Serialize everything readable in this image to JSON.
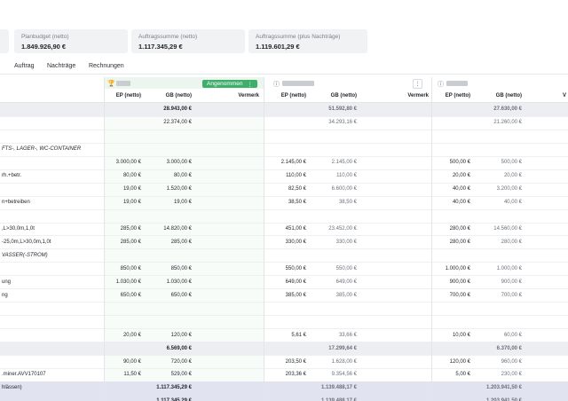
{
  "cards": [
    {
      "label": "Planbudget (netto)",
      "value": "1.849.926,90 €"
    },
    {
      "label": "Auftragssumme (netto)",
      "value": "1.117.345,29 €"
    },
    {
      "label": "Auftragssumme (plus Nachträge)",
      "value": "1.119.601,29 €"
    }
  ],
  "tabs": [
    "Auftrag",
    "Nachträge",
    "Rechnungen"
  ],
  "columns": {
    "status_badge": "Angenommen",
    "menu_glyph": "⋮",
    "info_glyph": "ⓘ",
    "group_a": {
      "ep": "EP (netto)",
      "gb": "GB (netto)",
      "vermerk": "Vermerk"
    },
    "group_b": {
      "ep": "EP (netto)",
      "gb": "GB (netto)",
      "vermerk": "Vermerk"
    },
    "group_c": {
      "ep": "EP (netto)",
      "gb": "GB (netto)",
      "vermerk": "V"
    }
  },
  "rows": [
    {
      "type": "sub",
      "desc": "",
      "a_ep": "",
      "a_gb": "28.943,00 €",
      "b_ep": "",
      "b_gb": "51.592,80 €",
      "c_ep": "",
      "c_gb": "27.630,00 €"
    },
    {
      "type": "plain",
      "desc": "",
      "a_ep": "",
      "a_gb": "22.374,00 €",
      "b_ep": "",
      "b_gb": "34.293,16 €",
      "c_ep": "",
      "c_gb": "21.260,00 €"
    },
    {
      "type": "plain",
      "desc": "",
      "a_ep": "",
      "a_gb": "",
      "b_ep": "",
      "b_gb": "",
      "c_ep": "",
      "c_gb": ""
    },
    {
      "type": "section",
      "desc": "FTS-, LAGER-, WC-CONTAINER",
      "a_ep": "",
      "a_gb": "",
      "b_ep": "",
      "b_gb": "",
      "c_ep": "",
      "c_gb": ""
    },
    {
      "type": "plain",
      "desc": "",
      "a_ep": "3.000,00 €",
      "a_gb": "3.000,00 €",
      "b_ep": "2.145,00 €",
      "b_gb": "2.145,00 €",
      "c_ep": "500,00 €",
      "c_gb": "500,00 €"
    },
    {
      "type": "plain",
      "desc": "rh.+betr.",
      "a_ep": "80,00 €",
      "a_gb": "80,00 €",
      "b_ep": "110,00 €",
      "b_gb": "110,00 €",
      "c_ep": "20,00 €",
      "c_gb": "20,00 €"
    },
    {
      "type": "plain",
      "desc": "",
      "a_ep": "19,00 €",
      "a_gb": "1.520,00 €",
      "b_ep": "82,50 €",
      "b_gb": "6.600,00 €",
      "c_ep": "40,00 €",
      "c_gb": "3.200,00 €"
    },
    {
      "type": "plain",
      "desc": "n+betreiben",
      "a_ep": "19,00 €",
      "a_gb": "19,00 €",
      "b_ep": "38,50 €",
      "b_gb": "38,50 €",
      "c_ep": "40,00 €",
      "c_gb": "40,00 €"
    },
    {
      "type": "plain",
      "desc": "",
      "a_ep": "",
      "a_gb": "",
      "b_ep": "",
      "b_gb": "",
      "c_ep": "",
      "c_gb": ""
    },
    {
      "type": "plain",
      "desc": ",L>30,0m,1,0t",
      "a_ep": "285,00 €",
      "a_gb": "14.820,00 €",
      "b_ep": "451,00 €",
      "b_gb": "23.452,00 €",
      "c_ep": "280,00 €",
      "c_gb": "14.560,00 €"
    },
    {
      "type": "plain",
      "desc": "-25,0m,L>30,0m,1,0t",
      "a_ep": "285,00 €",
      "a_gb": "285,00 €",
      "b_ep": "330,00 €",
      "b_gb": "330,00 €",
      "c_ep": "280,00 €",
      "c_gb": "280,00 €"
    },
    {
      "type": "section",
      "desc": "VASSER(-STROM)",
      "a_ep": "",
      "a_gb": "",
      "b_ep": "",
      "b_gb": "",
      "c_ep": "",
      "c_gb": ""
    },
    {
      "type": "plain",
      "desc": "",
      "a_ep": "850,00 €",
      "a_gb": "850,00 €",
      "b_ep": "550,00 €",
      "b_gb": "550,00 €",
      "c_ep": "1.000,00 €",
      "c_gb": "1.000,00 €"
    },
    {
      "type": "plain",
      "desc": "ung",
      "a_ep": "1.030,00 €",
      "a_gb": "1.030,00 €",
      "b_ep": "649,00 €",
      "b_gb": "649,00 €",
      "c_ep": "900,00 €",
      "c_gb": "900,00 €"
    },
    {
      "type": "plain",
      "desc": "ng",
      "a_ep": "650,00 €",
      "a_gb": "650,00 €",
      "b_ep": "385,00 €",
      "b_gb": "385,00 €",
      "c_ep": "700,00 €",
      "c_gb": "700,00 €"
    },
    {
      "type": "plain",
      "desc": "",
      "a_ep": "",
      "a_gb": "",
      "b_ep": "",
      "b_gb": "",
      "c_ep": "",
      "c_gb": ""
    },
    {
      "type": "plain",
      "desc": "",
      "a_ep": "",
      "a_gb": "",
      "b_ep": "",
      "b_gb": "",
      "c_ep": "",
      "c_gb": ""
    },
    {
      "type": "plain",
      "desc": "",
      "a_ep": "20,00 €",
      "a_gb": "120,00 €",
      "b_ep": "5,61 €",
      "b_gb": "33,66 €",
      "c_ep": "10,00 €",
      "c_gb": "60,00 €"
    },
    {
      "type": "sub",
      "desc": "",
      "a_ep": "",
      "a_gb": "6.569,00 €",
      "b_ep": "",
      "b_gb": "17.299,64 €",
      "c_ep": "",
      "c_gb": "6.370,00 €"
    },
    {
      "type": "plain",
      "desc": "",
      "a_ep": "90,00 €",
      "a_gb": "720,00 €",
      "b_ep": "203,50 €",
      "b_gb": "1.628,00 €",
      "c_ep": "120,00 €",
      "c_gb": "960,00 €"
    },
    {
      "type": "plain",
      "desc": ".miner.AVV170107",
      "a_ep": "11,50 €",
      "a_gb": "529,00 €",
      "b_ep": "203,36 €",
      "b_gb": "9.354,56 €",
      "c_ep": "5,00 €",
      "c_gb": "230,00 €"
    },
    {
      "type": "foot",
      "desc": "hlässen)",
      "a_ep": "",
      "a_gb": "1.117.345,29 €",
      "b_ep": "",
      "b_gb": "1.139.488,17 €",
      "c_ep": "",
      "c_gb": "1.203.941,50 €"
    },
    {
      "type": "foot",
      "desc": "",
      "a_ep": "",
      "a_gb": "1.117.345,29 €",
      "b_ep": "",
      "b_gb": "1.139.488,17 €",
      "c_ep": "",
      "c_gb": "1.203.941,50 €"
    }
  ]
}
